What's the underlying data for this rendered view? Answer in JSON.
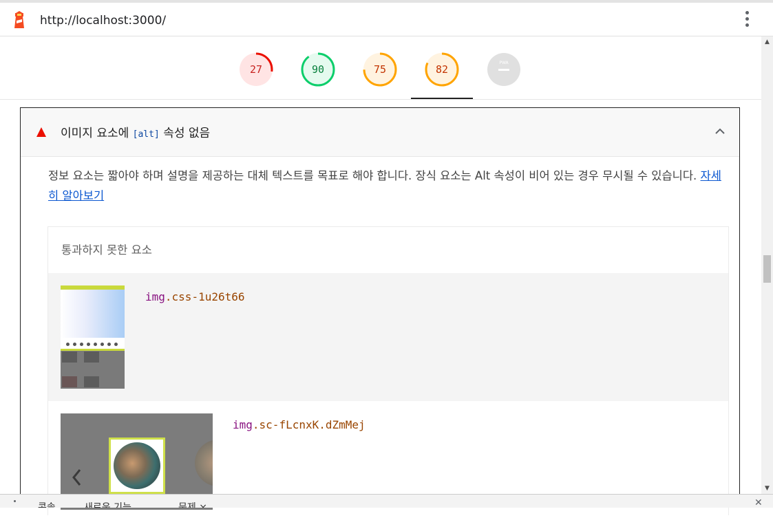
{
  "browser": {
    "url": "http://localhost:3000/",
    "menu_icon": "kebab-vertical-icon"
  },
  "scores": [
    {
      "label": "27",
      "value": 27,
      "color": "#eb0f00",
      "bg": "#ffe4e4"
    },
    {
      "label": "90",
      "value": 90,
      "color": "#0cce6b",
      "bg": "#e5faef"
    },
    {
      "label": "75",
      "value": 75,
      "color": "#ffa400",
      "bg": "#fff3e0"
    },
    {
      "label": "82",
      "value": 82,
      "color": "#ffa400",
      "bg": "#fff3e0"
    },
    {
      "label": "PWA",
      "value": 0,
      "color": "#bdbdbd",
      "bg": "#e0e0e0"
    }
  ],
  "audit": {
    "status_icon": "fail-triangle-icon",
    "title_prefix": "이미지 요소에 ",
    "title_code": "[alt]",
    "title_suffix": " 속성 없음",
    "description": "정보 요소는 짧아야 하며 설명을 제공하는 대체 텍스트를 목표로 해야 합니다. 장식 요소는 Alt 속성이 비어 있는 경우 무시될 수 있습니다. ",
    "learn_more": "자세히 알아보기",
    "details_header": "통과하지 못한 요소",
    "items": [
      {
        "tag": "img",
        "selector": ".css-1u26t66"
      },
      {
        "tag": "img",
        "selector": ".sc-fLcnxK.dZmMej"
      }
    ]
  },
  "drawer": {
    "tabs": [
      "콘솔",
      "새로운 기능",
      "문제 ×"
    ]
  }
}
